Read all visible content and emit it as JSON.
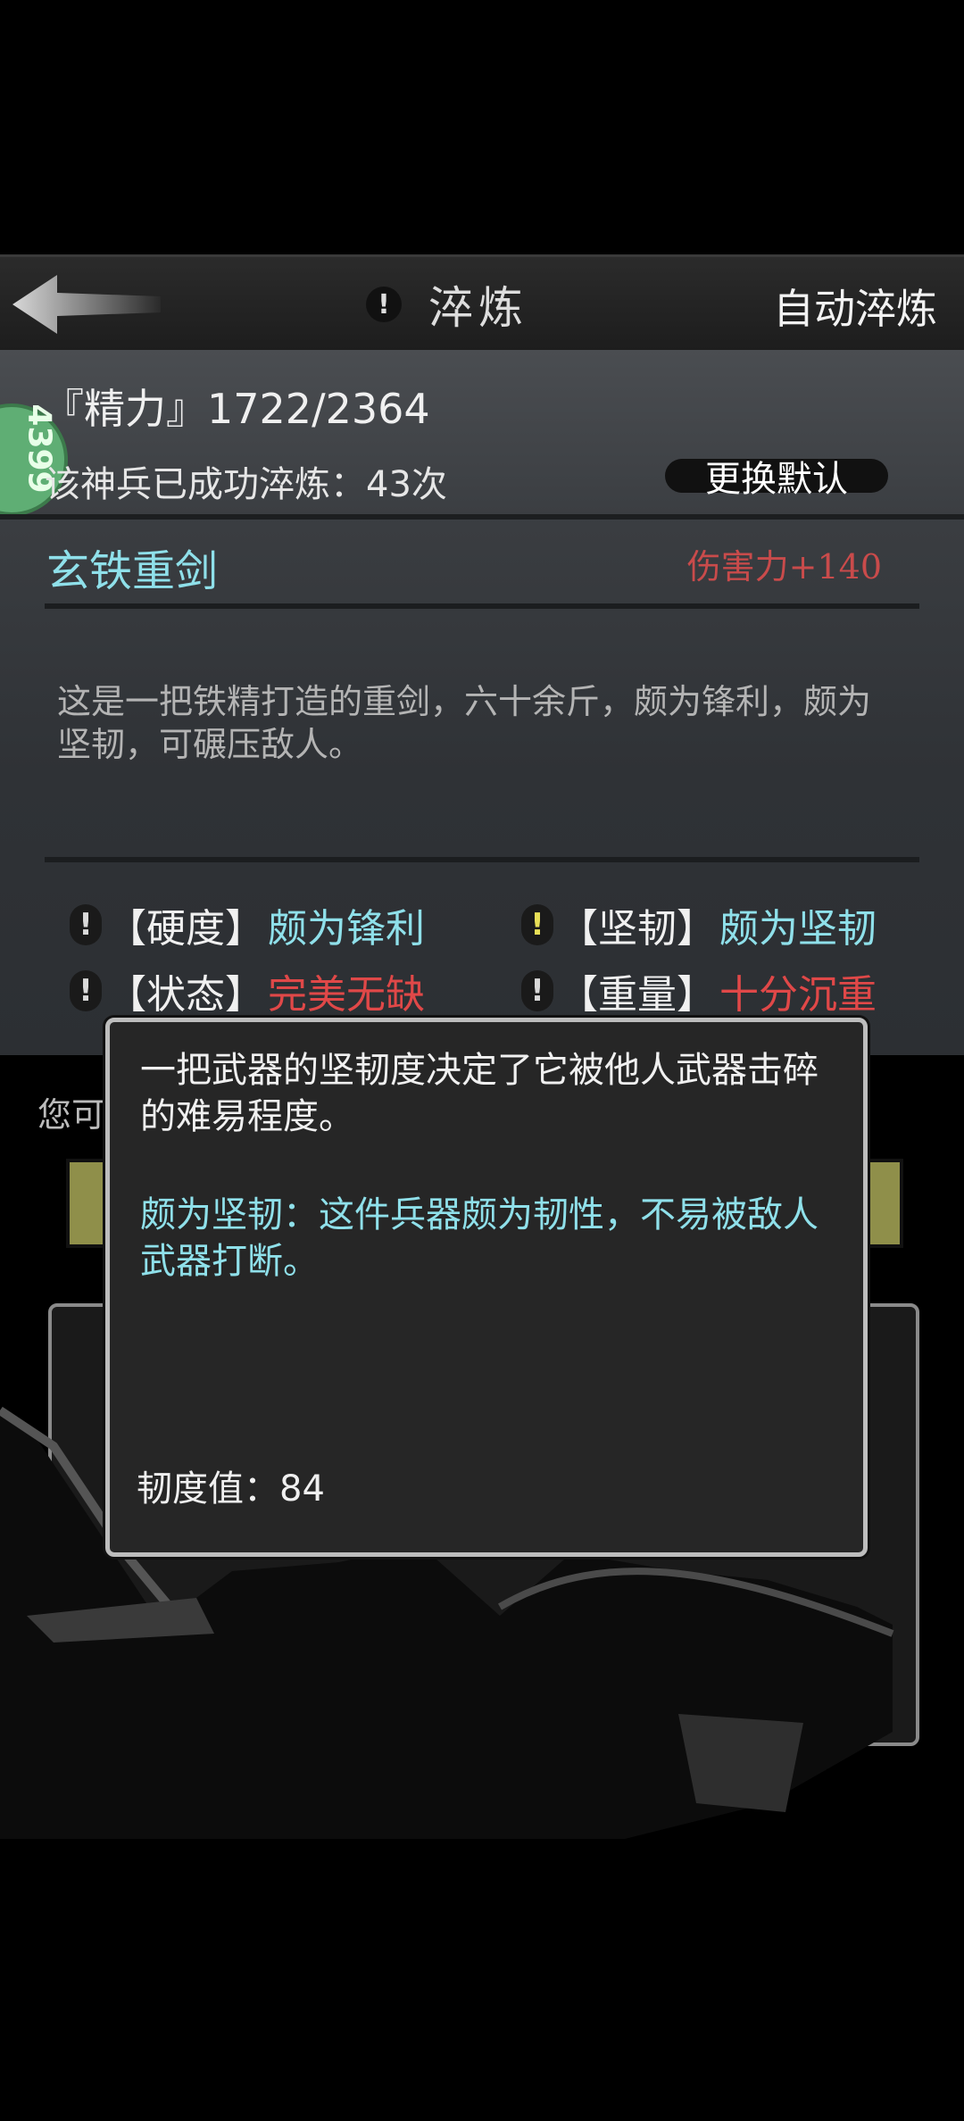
{
  "header": {
    "back_icon": "arrow-left-icon",
    "info_icon": "exclamation-icon",
    "title": "淬炼",
    "auto_refine": "自动淬炼"
  },
  "status": {
    "energy": "『精力』1722/2364",
    "badge_text": "4399",
    "refine_count": "该神兵已成功淬炼：43次",
    "change_default": "更换默认"
  },
  "weapon": {
    "name": "玄铁重剑",
    "damage": "伤害力+140",
    "description": "这是一把铁精打造的重剑，六十余斤，颇为锋利，颇为坚韧，可碾压敌人。"
  },
  "attributes": [
    {
      "key": "【硬度】",
      "value": "颇为锋利",
      "color": "#8fe0ea",
      "icon_color": "#d9d9d9"
    },
    {
      "key": "【坚韧】",
      "value": "颇为坚韧",
      "color": "#8fe0ea",
      "icon_color": "#e8df57"
    },
    {
      "key": "【状态】",
      "value": "完美无缺",
      "color": "#e04848",
      "icon_color": "#d9d9d9"
    },
    {
      "key": "【重量】",
      "value": "十分沉重",
      "color": "#e04848",
      "icon_color": "#d9d9d9"
    }
  ],
  "background": {
    "label_partial": "您可"
  },
  "popup": {
    "line1": "一把武器的坚韧度决定了它被他人武器击碎的难易程度。",
    "line2": "颇为坚韧：这件兵器颇为韧性，不易被敌人武器打断。",
    "value": "韧度值：84"
  }
}
